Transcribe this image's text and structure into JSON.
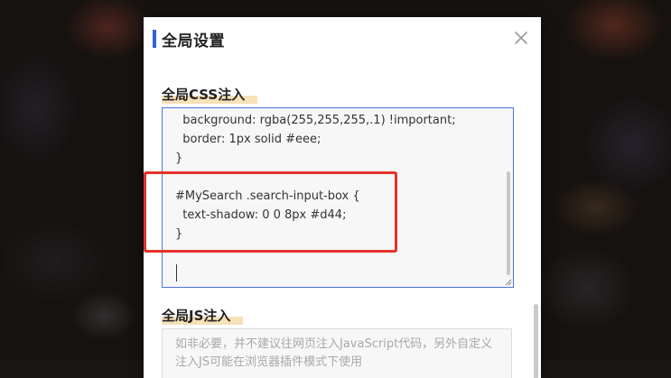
{
  "modal": {
    "title": "全局设置",
    "close_icon": "close-icon"
  },
  "css_section": {
    "label": "全局CSS注入",
    "code_lines": [
      "  background: rgba(255,255,255,.1) !important;",
      "  border: 1px solid #eee;",
      "}",
      "",
      "#MySearch .search-input-box {",
      "  text-shadow: 0 0 8px #d44;",
      "}"
    ]
  },
  "js_section": {
    "label": "全局JS注入",
    "placeholder": "如非必要，并不建议往网页注入JavaScript代码，另外自定义注入JS可能在浏览器插件模式下使用"
  },
  "colors": {
    "accent": "#2e63d7",
    "highlight": "#e5312b",
    "label_underline": "#f6e1b8"
  }
}
